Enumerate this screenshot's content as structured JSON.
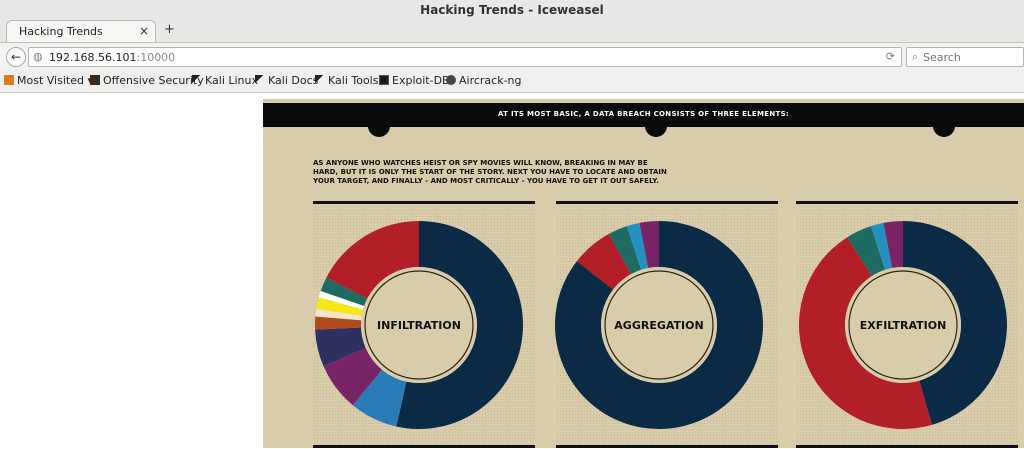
{
  "window": {
    "title": "Hacking Trends - Iceweasel"
  },
  "tabs": [
    {
      "label": "Hacking Trends",
      "close_glyph": "×"
    }
  ],
  "new_tab_glyph": "+",
  "nav": {
    "back_glyph": "←",
    "url_host": "192.168.56.101",
    "url_port": ":10000",
    "reload_glyph": "⟳",
    "search_placeholder": "Search"
  },
  "bookmarks": [
    {
      "label": "Most Visited ▾",
      "icon": "rss-icon"
    },
    {
      "label": "Offensive Security",
      "icon": "offsec-icon"
    },
    {
      "label": "Kali Linux",
      "icon": "kali-dragon-icon"
    },
    {
      "label": "Kali Docs",
      "icon": "kali-dragon-icon"
    },
    {
      "label": "Kali Tools",
      "icon": "kali-dragon-icon"
    },
    {
      "label": "Exploit-DB",
      "icon": "exploitdb-icon"
    },
    {
      "label": "Aircrack-ng",
      "icon": "aircrack-icon"
    }
  ],
  "infographic": {
    "banner": "AT ITS MOST BASIC, A DATA BREACH CONSISTS OF THREE ELEMENTS:",
    "intro": "AS ANYONE WHO WATCHES HEIST OR SPY MOVIES WILL KNOW, BREAKING IN MAY BE HARD, BUT IT IS ONLY THE START OF THE STORY. NEXT YOU HAVE TO LOCATE AND OBTAIN YOUR TARGET, AND FINALLY - AND MOST CRITICALLY - YOU HAVE TO GET IT OUT SAFELY.",
    "colors": {
      "background": "#d9ccaa",
      "navy": "#0b2a45",
      "red": "#b21f27"
    },
    "donuts": [
      {
        "label": "INFILTRATION",
        "segments": [
          {
            "value": 0.535,
            "color": "#0b2a45"
          },
          {
            "value": 0.075,
            "color": "#2a7cb8"
          },
          {
            "value": 0.075,
            "color": "#7a2468"
          },
          {
            "value": 0.058,
            "color": "#2e3060"
          },
          {
            "value": 0.02,
            "color": "#b24a20"
          },
          {
            "value": 0.012,
            "color": "#f0e6c8"
          },
          {
            "value": 0.018,
            "color": "#f5e61a"
          },
          {
            "value": 0.01,
            "color": "#ffffff"
          },
          {
            "value": 0.022,
            "color": "#1f6b63"
          },
          {
            "value": 0.175,
            "color": "#b21f27"
          }
        ]
      },
      {
        "label": "AGGREGATION",
        "segments": [
          {
            "value": 0.855,
            "color": "#0b2a45"
          },
          {
            "value": 0.065,
            "color": "#b21f27"
          },
          {
            "value": 0.03,
            "color": "#1f6b63"
          },
          {
            "value": 0.02,
            "color": "#2490c0"
          },
          {
            "value": 0.03,
            "color": "#7a2468"
          }
        ]
      },
      {
        "label": "EXFILTRATION",
        "segments": [
          {
            "value": 0.455,
            "color": "#0b2a45"
          },
          {
            "value": 0.455,
            "color": "#b21f27"
          },
          {
            "value": 0.04,
            "color": "#1f6b63"
          },
          {
            "value": 0.02,
            "color": "#2490c0"
          },
          {
            "value": 0.03,
            "color": "#7a2468"
          }
        ]
      }
    ]
  }
}
